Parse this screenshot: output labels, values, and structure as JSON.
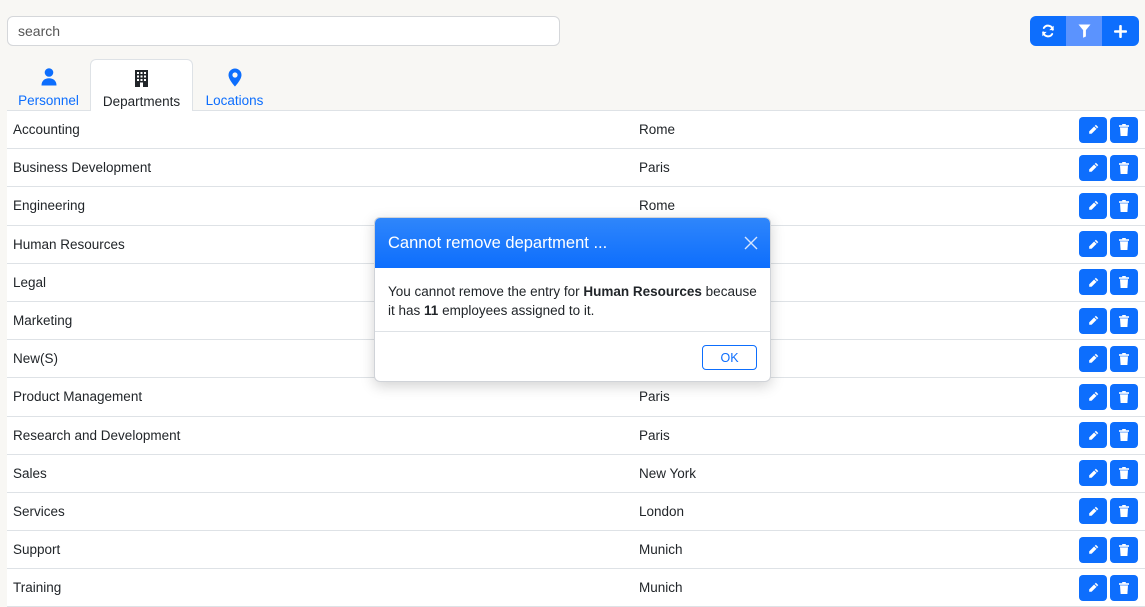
{
  "search": {
    "placeholder": "search",
    "value": ""
  },
  "toolbar": {
    "refresh_icon": "refresh-icon",
    "filter_icon": "filter-icon",
    "add_icon": "plus-icon"
  },
  "tabs": [
    {
      "label": "Personnel",
      "icon": "person-icon",
      "active": false
    },
    {
      "label": "Departments",
      "icon": "building-icon",
      "active": true
    },
    {
      "label": "Locations",
      "icon": "map-pin-icon",
      "active": false
    }
  ],
  "departments": [
    {
      "name": "Accounting",
      "location": "Rome"
    },
    {
      "name": "Business Development",
      "location": "Paris"
    },
    {
      "name": "Engineering",
      "location": "Rome"
    },
    {
      "name": "Human Resources",
      "location": ""
    },
    {
      "name": "Legal",
      "location": ""
    },
    {
      "name": "Marketing",
      "location": ""
    },
    {
      "name": "New(S)",
      "location": ""
    },
    {
      "name": "Product Management",
      "location": "Paris"
    },
    {
      "name": "Research and Development",
      "location": "Paris"
    },
    {
      "name": "Sales",
      "location": "New York"
    },
    {
      "name": "Services",
      "location": "London"
    },
    {
      "name": "Support",
      "location": "Munich"
    },
    {
      "name": "Training",
      "location": "Munich"
    }
  ],
  "modal": {
    "title": "Cannot remove department ...",
    "body_pre": "You cannot remove the entry for ",
    "department": "Human Resources",
    "body_mid": " because it has ",
    "count": "11",
    "body_post": " employees assigned to it.",
    "ok_label": "OK"
  },
  "colors": {
    "primary": "#0d6efd",
    "filter_button": "#5b93fe"
  }
}
